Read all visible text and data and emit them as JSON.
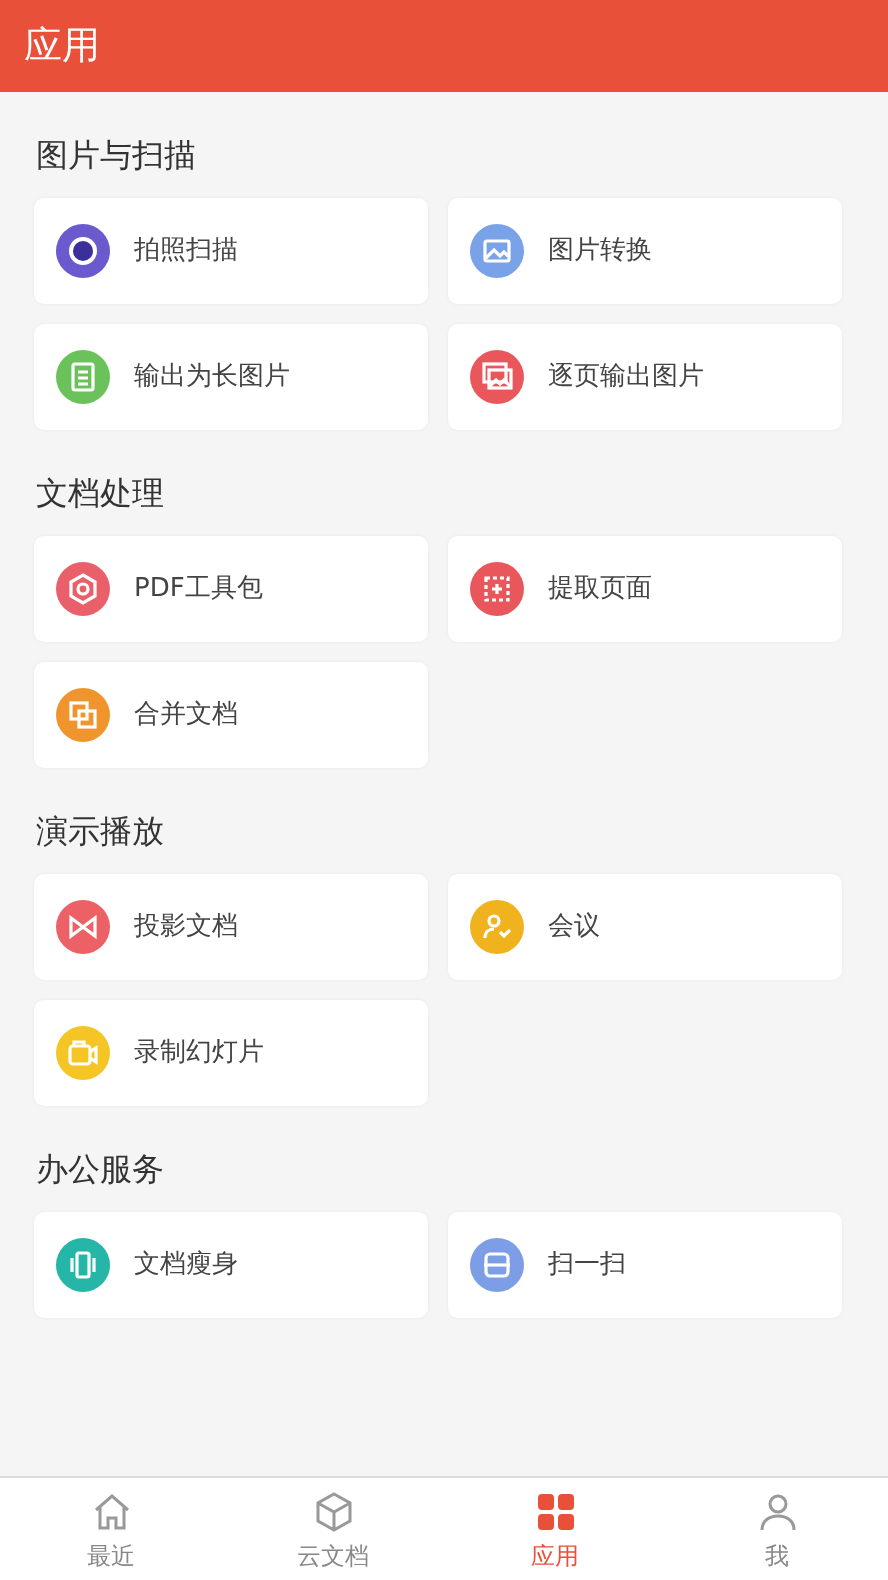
{
  "header": {
    "title": "应用"
  },
  "sections": [
    {
      "title": "图片与扫描",
      "items": [
        {
          "label": "拍照扫描",
          "color": "#6a5acd"
        },
        {
          "label": "图片转换",
          "color": "#7aa2e8"
        },
        {
          "label": "输出为长图片",
          "color": "#6cc25a"
        },
        {
          "label": "逐页输出图片",
          "color": "#e9575c"
        }
      ]
    },
    {
      "title": "文档处理",
      "items": [
        {
          "label": "PDF工具包",
          "color": "#e9606a"
        },
        {
          "label": "提取页面",
          "color": "#e9575c"
        },
        {
          "label": "合并文档",
          "color": "#f0952e"
        }
      ]
    },
    {
      "title": "演示播放",
      "items": [
        {
          "label": "投影文档",
          "color": "#ec6165"
        },
        {
          "label": "会议",
          "color": "#f1b31d"
        },
        {
          "label": "录制幻灯片",
          "color": "#f4c524"
        }
      ]
    },
    {
      "title": "办公服务",
      "items": [
        {
          "label": "文档瘦身",
          "color": "#25b6a8"
        },
        {
          "label": "扫一扫",
          "color": "#7d9ee6"
        }
      ]
    }
  ],
  "tabs": [
    {
      "label": "最近",
      "selected": false
    },
    {
      "label": "云文档",
      "selected": false
    },
    {
      "label": "应用",
      "selected": true
    },
    {
      "label": "我",
      "selected": false
    }
  ]
}
